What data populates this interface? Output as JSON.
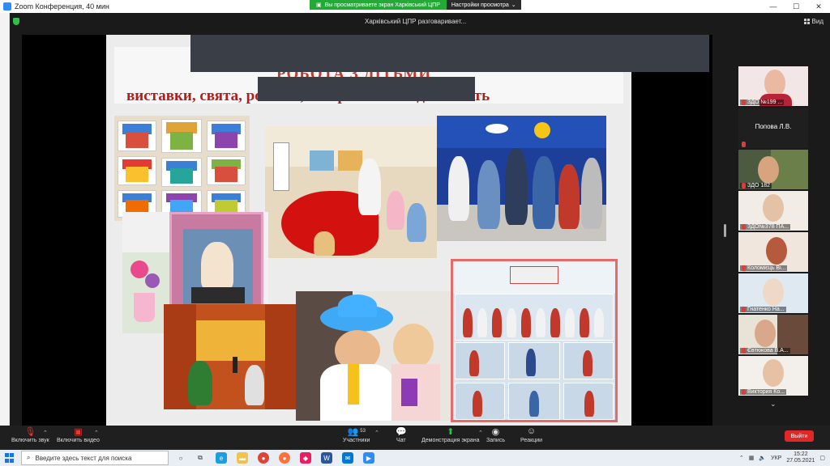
{
  "window": {
    "title": "Zoom Конференция, 40 мин"
  },
  "share_banner": {
    "message": "Вы просматриваете экран Харківський ЦПР",
    "view_options": "Настройки просмотра"
  },
  "speaker": {
    "label": "Харківський ЦПР разговаривает..."
  },
  "view_button": {
    "label": "Вид"
  },
  "slide": {
    "title_line1": "РОБОТА З ДІТЬМИ",
    "title_line2": "виставки, свята, розваги, театралізована діяльність"
  },
  "participants": [
    {
      "name": "ЗДО №199 ...",
      "has_video": true,
      "muted": true
    },
    {
      "name": "Попова Л.В.",
      "has_video": false,
      "muted": true
    },
    {
      "name": "ЗДО 182",
      "has_video": true,
      "muted": true
    },
    {
      "name": "ЗДО№378 ПА...",
      "has_video": true,
      "muted": true
    },
    {
      "name": "Коломієць Ві...",
      "has_video": true,
      "muted": true
    },
    {
      "name": "Гнатенко На...",
      "has_video": true,
      "muted": true
    },
    {
      "name": "Євтюкова В.А...",
      "has_video": true,
      "muted": true
    },
    {
      "name": "Виктория Ко...",
      "has_video": true,
      "muted": true
    }
  ],
  "toolbar": {
    "audio": "Включить звук",
    "video": "Включить видео",
    "participants": "Участники",
    "participants_count": "53",
    "chat": "Чат",
    "share": "Демонстрация экрана",
    "record": "Запись",
    "reactions": "Реакции",
    "leave": "Выйти"
  },
  "taskbar": {
    "search_placeholder": "Введите здесь текст для поиска",
    "lang": "УКР",
    "time": "15:22",
    "date": "27.05.2021"
  },
  "colors": {
    "share_green": "#23a936",
    "leave_red": "#e02828",
    "slide_title_red": "#b71c1c"
  }
}
